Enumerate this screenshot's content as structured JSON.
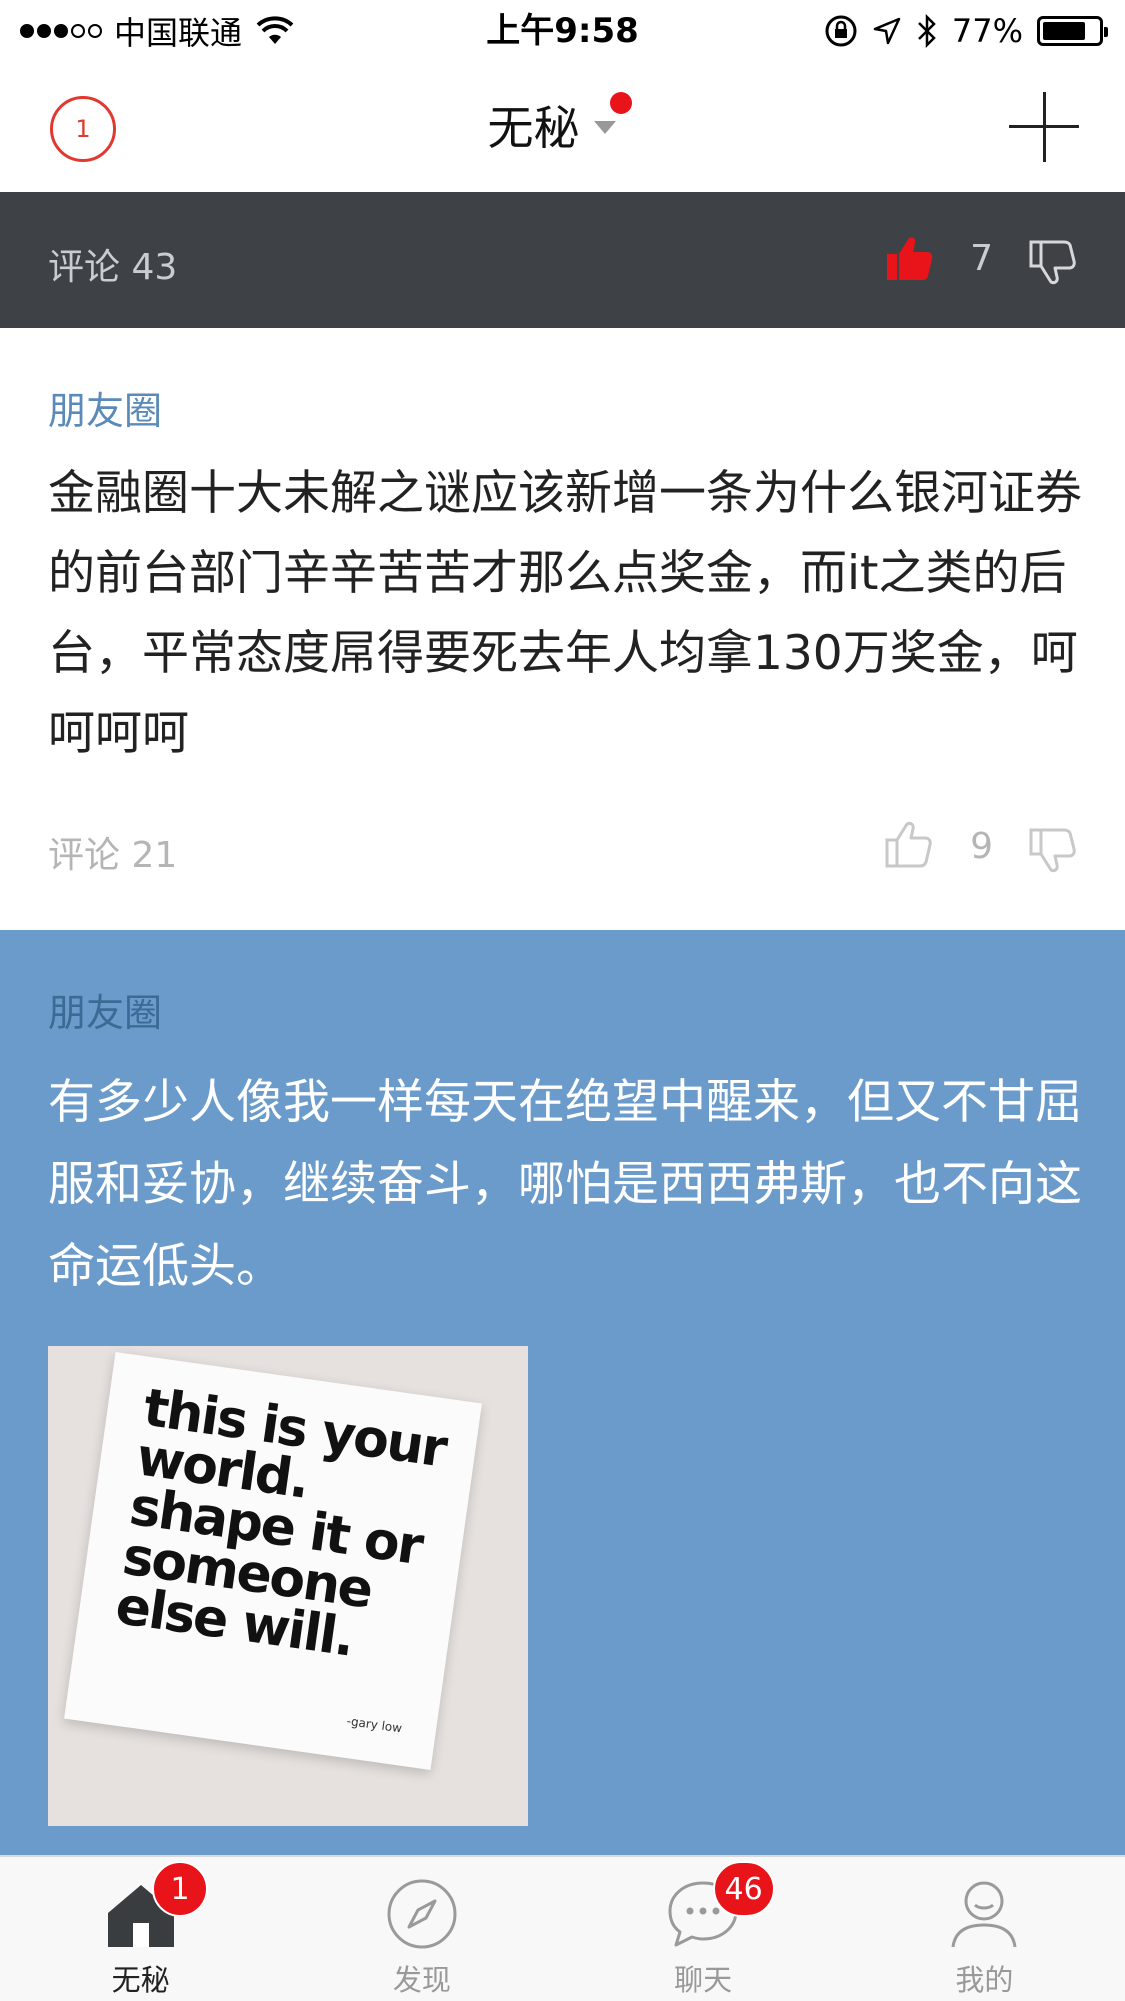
{
  "status_bar": {
    "carrier": "中国联通",
    "time": "上午9:58",
    "battery_percent": "77%",
    "battery_level": 0.77
  },
  "nav": {
    "badge": "1",
    "title": "无秘"
  },
  "top_strip": {
    "comments": "评论 43",
    "likes": "7"
  },
  "posts": [
    {
      "source": "朋友圈",
      "text": "金融圈十大未解之谜应该新增一条为什么银河证券的前台部门辛辛苦苦才那么点奖金，而it之类的后台，平常态度屌得要死去年人均拿130万奖金，呵呵呵呵",
      "comments": "评论 21",
      "likes": "9"
    },
    {
      "source": "朋友圈",
      "text": "有多少人像我一样每天在绝望中醒来，但又不甘屈服和妥协，继续奋斗，哪怕是西西弗斯，也不向这命运低头。",
      "image_text": "this is your world. shape it or someone else will.",
      "image_signature": "-gary low"
    }
  ],
  "tabbar": {
    "tabs": [
      {
        "label": "无秘",
        "badge": "1"
      },
      {
        "label": "发现"
      },
      {
        "label": "聊天",
        "badge": "46"
      },
      {
        "label": "我的"
      }
    ]
  },
  "colors": {
    "accent_red": "#e8141a",
    "dark_strip": "#3e4246",
    "post_blue": "#6a9bcb",
    "source_blue": "#5a8bb8"
  }
}
